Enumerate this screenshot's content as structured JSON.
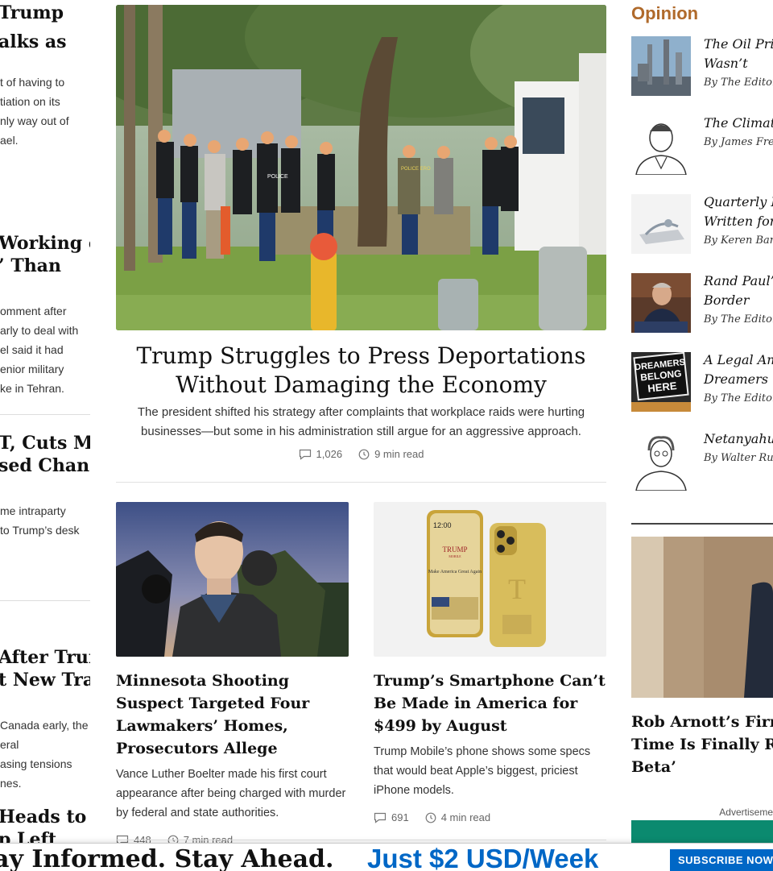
{
  "left_column": {
    "blocks": [
      {
        "headline": [
          "Trump",
          "alks as"
        ],
        "summary": [
          "t of having to",
          "tiation on its",
          "nly way out of",
          "ael."
        ]
      },
      {
        "headline": [
          "Working on",
          "’ Than"
        ],
        "summary": [
          "omment after",
          "arly to deal with",
          "el said it had",
          "enior military",
          "ke in Tehran."
        ]
      },
      {
        "headline": [
          "T, Cuts More",
          "sed Changes"
        ],
        "summary": [
          "me intraparty",
          "to Trump’s desk"
        ]
      },
      {
        "headline": [
          "After Trump",
          "t New Trade"
        ],
        "summary": [
          "Canada early, the",
          "eral",
          "asing tensions",
          "nes."
        ]
      },
      {
        "headline": [
          " Heads to",
          "p Left"
        ],
        "summary": []
      }
    ]
  },
  "hero": {
    "title": "Trump Struggles to Press Deportations Without Damaging the Economy",
    "summary": "The president shifted his strategy after complaints that workplace raids were hurting businesses—but some in his administration still argue for an aggressive approach.",
    "comments": "1,026",
    "read_time": "9 min read",
    "vest_label_1": "POLICE",
    "vest_label_2": "POLICE ERO"
  },
  "cards": [
    {
      "title": "Minnesota Shooting Suspect Targeted Four Lawmakers’ Homes, Prosecutors Allege",
      "summary": "Vance Luther Boelter made his first court appearance after being charged with murder by federal and state authorities.",
      "comments": "448",
      "read_time": "7 min read"
    },
    {
      "title": "Trump’s Smartphone Can’t Be Made in America for $499 by August",
      "summary": "Trump Mobile’s phone shows some specs that would beat Apple’s biggest, priciest iPhone models.",
      "comments": "691",
      "read_time": "4 min read",
      "phone": {
        "time": "12:00",
        "brand": "TRUMP",
        "sub": "MOBILE",
        "slogan": "Make America Great Again",
        "logo": "T"
      }
    }
  ],
  "opinion": {
    "section_title": "Opinion",
    "items": [
      {
        "headline": [
          "The Oil Pric",
          "Wasn’t"
        ],
        "byline": "By The Editor"
      },
      {
        "headline": [
          "The Climate"
        ],
        "byline": "By James Fred"
      },
      {
        "headline": [
          "Quarterly Re",
          "Written for A"
        ],
        "byline": "By Keren Bar-"
      },
      {
        "headline": [
          "Rand Paul’s",
          "Border"
        ],
        "byline": "By The Editor"
      },
      {
        "headline": [
          "A Legal Am",
          "Dreamers"
        ],
        "byline": "By The Editor",
        "sign": [
          "DREAMERS",
          "BELONG",
          "HERE"
        ]
      },
      {
        "headline": [
          "Netanyahu I"
        ],
        "byline": "By Walter Rus"
      }
    ]
  },
  "right_story": {
    "title": [
      "Rob Arnott’s Firm",
      "Time Is Finally Rig",
      "Beta’"
    ]
  },
  "ad": {
    "label": "Advertiseme"
  },
  "banner": {
    "left_text": "ay Informed. Stay Ahead.",
    "price": "Just $2 USD/Week",
    "button": "SUBSCRIBE NOW"
  },
  "colors": {
    "opinion_accent": "#b06a2b",
    "subscribe_blue": "#0067c6",
    "ad_green": "#0b8a6f"
  }
}
